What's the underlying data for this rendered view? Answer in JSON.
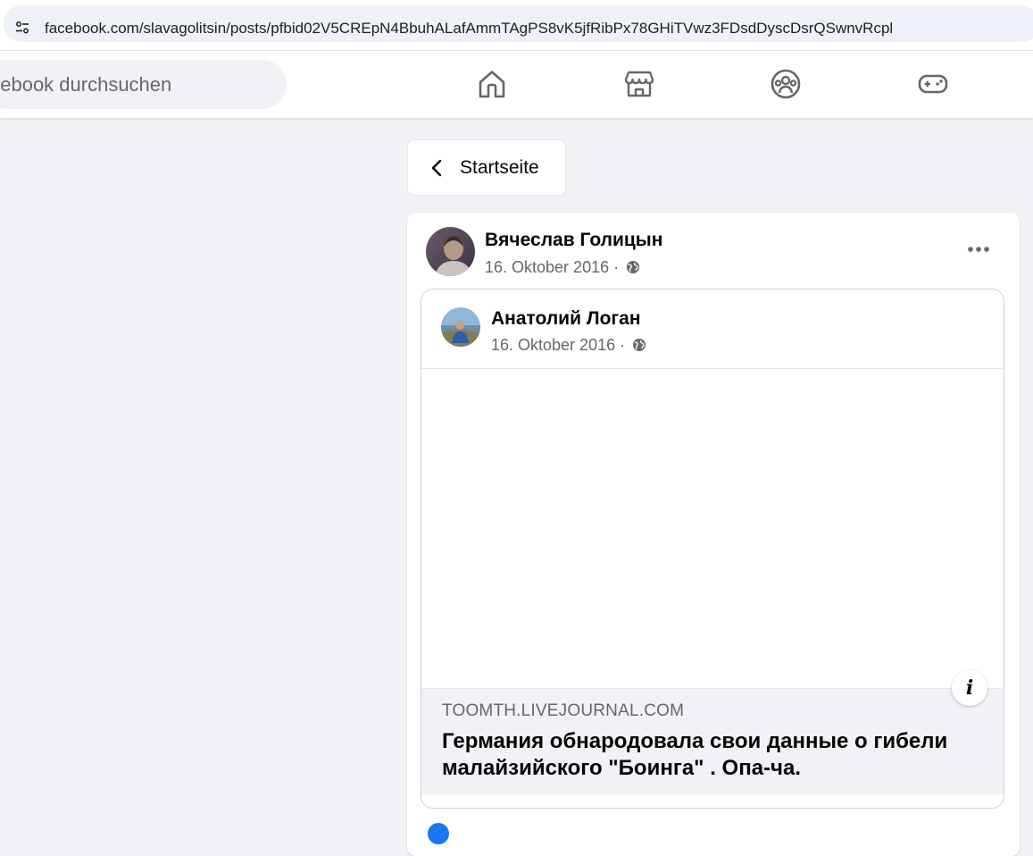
{
  "browser": {
    "url": "facebook.com/slavagolitsin/posts/pfbid02V5CREpN4BbuhALafAmmTAgPS8vK5jfRibPx78GHiTVwz3FDsdDyscDsrQSwnvRcpl"
  },
  "header": {
    "search_placeholder": "acebook durchsuchen",
    "nav_icons": [
      "home-icon",
      "marketplace-icon",
      "groups-icon",
      "gaming-icon"
    ]
  },
  "back_button": {
    "label": "Startseite"
  },
  "post": {
    "author": "Вячеслав Голицын",
    "date": "16. Oktober 2016 ·",
    "more_icon": "more-options-icon",
    "shared": {
      "author": "Анатолий Логан",
      "date": "16. Oktober 2016 ·",
      "link": {
        "domain": "TOOMTH.LIVEJOURNAL.COM",
        "title": "Германия обнародовала свои данные о гибели малайзийского \"Боинга\" . Опа-ча."
      },
      "info_glyph": "i"
    }
  },
  "colors": {
    "background": "#f0f2f5",
    "card": "#ffffff",
    "secondary_text": "#65676b",
    "accent": "#1877f2"
  }
}
